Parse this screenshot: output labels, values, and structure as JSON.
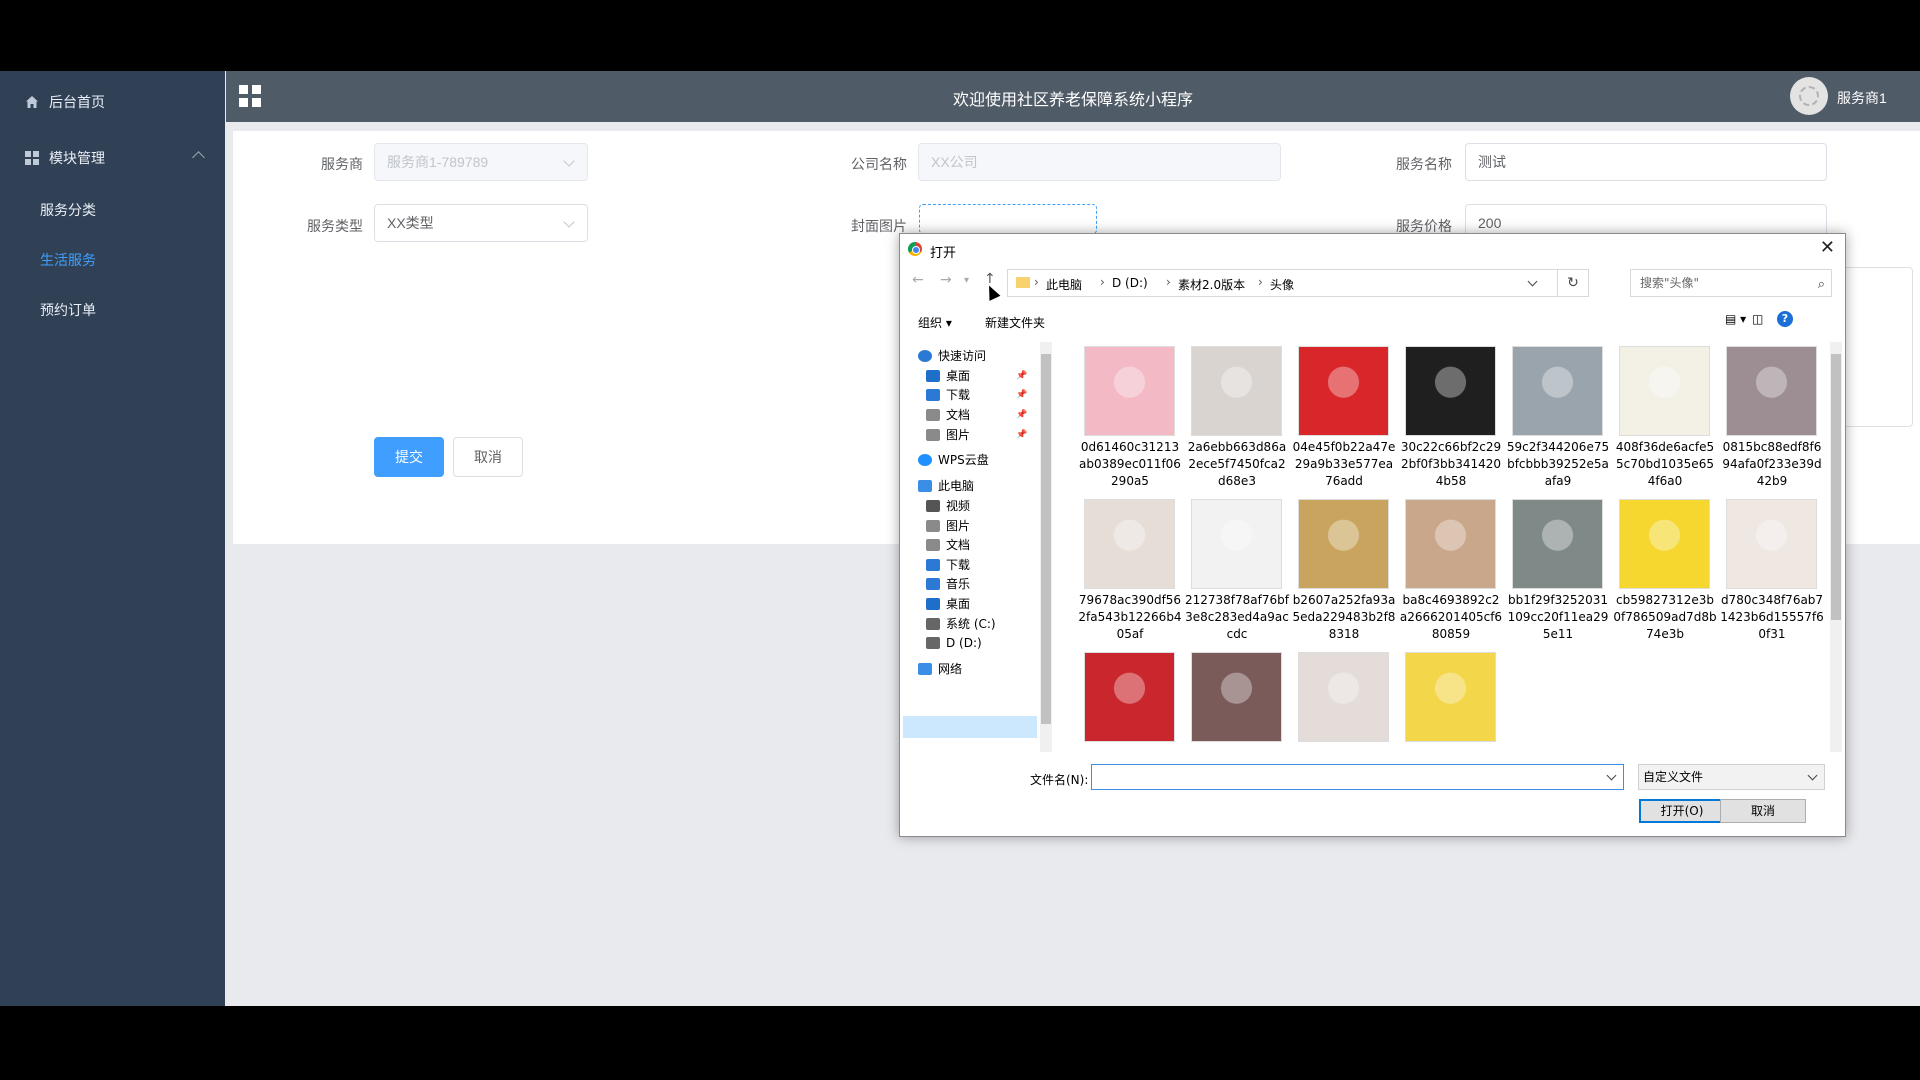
{
  "sidebar": {
    "home_label": "后台首页",
    "module_label": "模块管理",
    "items": [
      {
        "label": "服务分类",
        "active": false
      },
      {
        "label": "生活服务",
        "active": true
      },
      {
        "label": "预约订单",
        "active": false
      }
    ]
  },
  "header": {
    "title": "欢迎使用社区养老保障系统小程序",
    "user_name": "服务商1"
  },
  "form": {
    "provider_label": "服务商",
    "provider_value": "服务商1-789789",
    "company_label": "公司名称",
    "company_placeholder": "XX公司",
    "service_name_label": "服务名称",
    "service_name_value": "测试",
    "service_type_label": "服务类型",
    "service_type_value": "XX类型",
    "cover_label": "封面图片",
    "price_label": "服务价格",
    "price_value": "200",
    "submit_label": "提交",
    "cancel_label": "取消"
  },
  "dialog": {
    "title": "打开",
    "breadcrumbs": [
      "此电脑",
      "D (D:)",
      "素材2.0版本",
      "头像"
    ],
    "search_placeholder": "搜索\"头像\"",
    "organize_label": "组织 ▾",
    "new_folder_label": "新建文件夹",
    "help_label": "?",
    "nav": [
      {
        "label": "快速访问",
        "icon": "star-icon",
        "level": 0
      },
      {
        "label": "桌面",
        "icon": "desktop-icon",
        "level": 1,
        "pinned": true
      },
      {
        "label": "下载",
        "icon": "download-icon",
        "level": 1,
        "pinned": true
      },
      {
        "label": "文档",
        "icon": "document-icon",
        "level": 1,
        "pinned": true
      },
      {
        "label": "图片",
        "icon": "picture-icon",
        "level": 1,
        "pinned": true
      },
      {
        "label": "WPS云盘",
        "icon": "cloud-icon",
        "level": 0
      },
      {
        "label": "此电脑",
        "icon": "computer-icon",
        "level": 0
      },
      {
        "label": "视频",
        "icon": "video-icon",
        "level": 1
      },
      {
        "label": "图片",
        "icon": "picture-icon",
        "level": 1
      },
      {
        "label": "文档",
        "icon": "document-icon",
        "level": 1
      },
      {
        "label": "下载",
        "icon": "download-icon",
        "level": 1
      },
      {
        "label": "音乐",
        "icon": "music-icon",
        "level": 1
      },
      {
        "label": "桌面",
        "icon": "desktop-icon",
        "level": 1
      },
      {
        "label": "系统 (C:)",
        "icon": "drive-icon",
        "level": 1
      },
      {
        "label": "D (D:)",
        "icon": "drive-icon",
        "level": 1,
        "selected": true
      },
      {
        "label": "网络",
        "icon": "network-icon",
        "level": 0
      }
    ],
    "files": [
      {
        "name": "0d61460c31213ab0389ec011f06290a5",
        "color": "#f3b9c5"
      },
      {
        "name": "2a6ebb663d86a2ece5f7450fca2d68e3",
        "color": "#d9d4d0"
      },
      {
        "name": "04e45f0b22a47e29a9b33e577ea76add",
        "color": "#d8262a"
      },
      {
        "name": "30c22c66bf2c292bf0f3bb3414204b58",
        "color": "#1f1f1f"
      },
      {
        "name": "59c2f344206e75bfcbbb39252e5aafa9",
        "color": "#9aa4ad"
      },
      {
        "name": "408f36de6acfe55c70bd1035e654f6a0",
        "color": "#f3f0e6"
      },
      {
        "name": "0815bc88edf8f694afa0f233e39d42b9",
        "color": "#9c8e93"
      },
      {
        "name": "79678ac390df562fa543b12266b405af",
        "color": "#e7ddd7"
      },
      {
        "name": "212738f78af76bf3e8c283ed4a9accdc",
        "color": "#f2f2f2"
      },
      {
        "name": "b2607a252fa93a5eda229483b2f88318",
        "color": "#c8a45e"
      },
      {
        "name": "ba8c4693892c2a2666201405cf680859",
        "color": "#c9a78a"
      },
      {
        "name": "bb1f29f3252031109cc20f11ea295e11",
        "color": "#7f8a88"
      },
      {
        "name": "cb59827312e3b0f786509ad7d8b74e3b",
        "color": "#f5d730"
      },
      {
        "name": "d780c348f76ab71423b6d15557f60f31",
        "color": "#eee7e2"
      },
      {
        "name": "",
        "color": "#c9272d"
      },
      {
        "name": "",
        "color": "#7b5b5a"
      },
      {
        "name": "",
        "color": "#e4dcd8"
      },
      {
        "name": "",
        "color": "#f3d64a"
      }
    ],
    "filename_label": "文件名(N):",
    "filename_value": "",
    "filetype_value": "自定义文件",
    "open_label": "打开(O)",
    "cancel_label": "取消"
  },
  "colors": {
    "sidebar_bg": "#304156",
    "header_bg": "#4f5b66",
    "accent": "#409eff"
  }
}
